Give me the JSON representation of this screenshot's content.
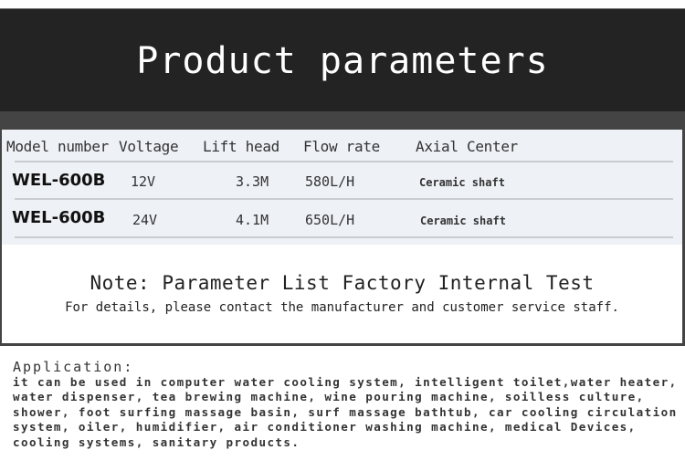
{
  "header": {
    "title": "Product parameters"
  },
  "table": {
    "columns": [
      "Model number",
      "Voltage",
      "Lift head",
      "Flow rate",
      "Axial Center"
    ],
    "rows": [
      {
        "model": "WEL-600B",
        "voltage": "12V",
        "lift_head": "3.3M",
        "flow_rate": "580L/H",
        "axial_center": "Ceramic shaft"
      },
      {
        "model": "WEL-600B",
        "voltage": "24V",
        "lift_head": "4.1M",
        "flow_rate": "650L/H",
        "axial_center": "Ceramic shaft"
      }
    ]
  },
  "note": {
    "title": "Note: Parameter List Factory Internal Test",
    "subtitle": "For details, please contact the manufacturer and customer service staff."
  },
  "application": {
    "title": "Application:",
    "lines": [
      "it can be used in computer water cooling system, intelligent toilet,water heater,",
      "water dispenser, tea brewing machine, wine pouring machine, soilless culture,",
      "shower, foot surfing massage basin, surf massage bathtub, car cooling circulation",
      "system, oiler, humidifier, air conditioner washing machine, medical Devices,",
      "cooling systems, sanitary products."
    ]
  }
}
